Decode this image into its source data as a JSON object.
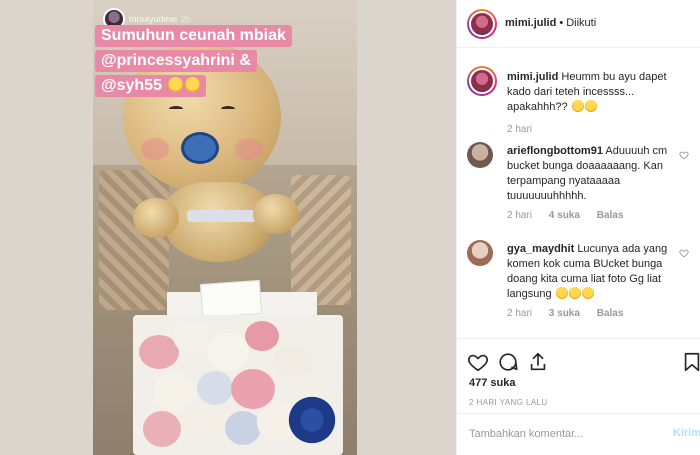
{
  "story": {
    "username": "mrsayudewi",
    "time": "2h",
    "sticker_lines": [
      "Sumuhun ceunah mbiak",
      "@princessyahrini &",
      "@syh55"
    ]
  },
  "header": {
    "username": "mimi.julid",
    "dot": "•",
    "follow_status": "Diikuti"
  },
  "caption": {
    "username": "mimi.julid",
    "text": "Heumm bu ayu dapet kado dari teteh incessss... apakahhh??",
    "time": "2 hari"
  },
  "comments": [
    {
      "username": "arieflongbottom91",
      "text": "Aduuuuh cm bucket bunga doaaaaaang. Kan terpampang nyataaaaa tuuuuuuuhhhhh.",
      "time": "2 hari",
      "likes": "4 suka",
      "reply": "Balas"
    },
    {
      "username": "gya_maydhit",
      "text": "Lucunya ada yang komen kok cuma BUcket bunga doang kita cuma liat foto Gg liat langsung",
      "time": "2 hari",
      "likes": "3 suka",
      "reply": "Balas"
    }
  ],
  "likes": "477 suka",
  "date": "2 HARI YANG LALU",
  "comment_box": {
    "placeholder": "Tambahkan komentar...",
    "post_label": "Kirim"
  },
  "colors": {
    "sticker": "#e88aa6",
    "post_button_disabled": "#b2dffc"
  },
  "icons": [
    "heart-icon",
    "comment-icon",
    "share-icon",
    "bookmark-icon"
  ]
}
